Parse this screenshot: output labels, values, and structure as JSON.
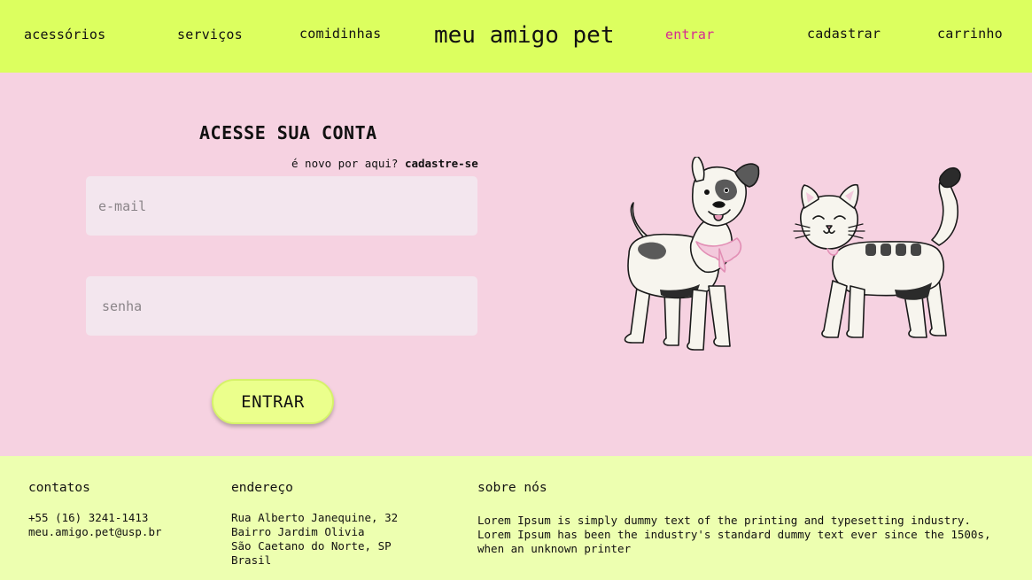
{
  "nav": {
    "accessories": "acessórios",
    "services": "serviços",
    "food": "comidinhas",
    "brand": "meu amigo pet",
    "login": "entrar",
    "register": "cadastrar",
    "cart": "carrinho"
  },
  "login": {
    "title": "ACESSE SUA CONTA",
    "new_here": "é novo por aqui?",
    "signup_link": "cadastre-se",
    "email_placeholder": "e-mail",
    "password_placeholder": "senha",
    "submit_label": "ENTRAR"
  },
  "footer": {
    "contacts": {
      "title": "contatos",
      "phone": "+55 (16) 3241-1413",
      "email": "meu.amigo.pet@usp.br"
    },
    "address": {
      "title": "endereço",
      "line1": "Rua Alberto Janequine, 32",
      "line2": "Bairro Jardim Olivia",
      "line3": "São Caetano do Norte, SP",
      "line4": "Brasil"
    },
    "about": {
      "title": "sobre nós",
      "text": "Lorem Ipsum is simply dummy text of the printing and typesetting industry. Lorem Ipsum has been the industry's standard dummy text ever since the 1500s, when an unknown printer"
    }
  },
  "colors": {
    "header_bg": "#dcff5f",
    "main_bg": "#f6d2e1",
    "footer_bg": "#edffb0",
    "active_link": "#d62a93",
    "button_bg": "#ebff8c"
  }
}
